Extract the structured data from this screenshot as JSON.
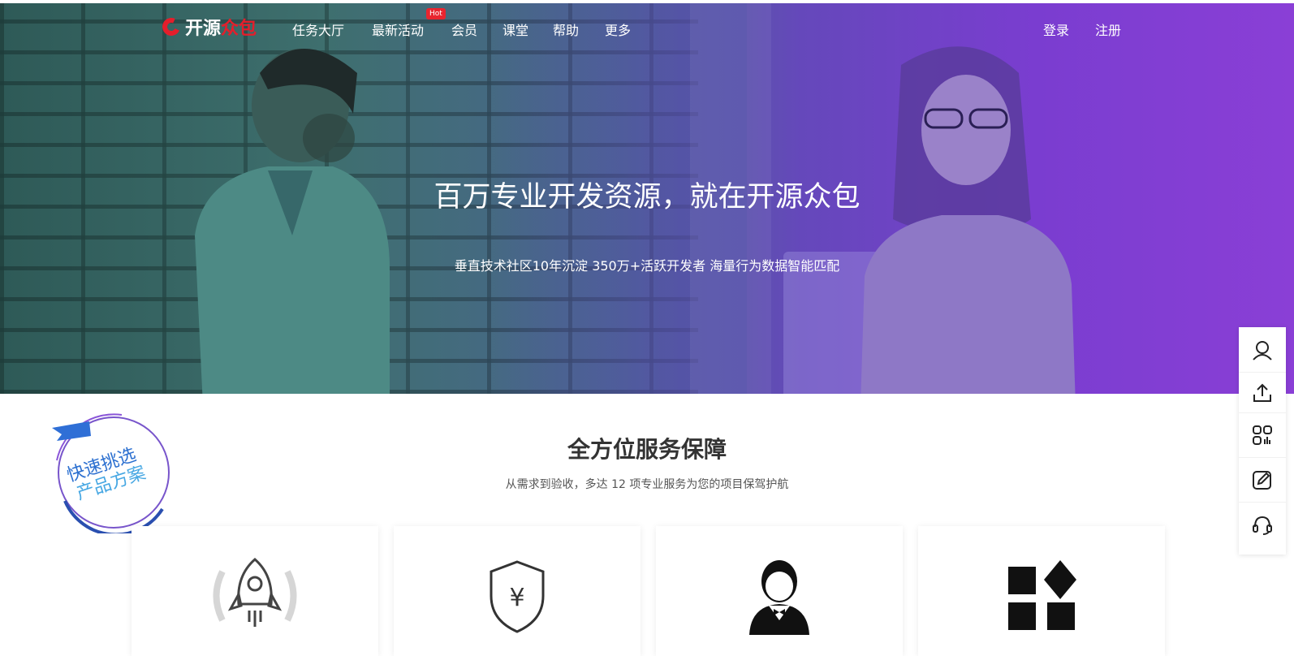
{
  "brand": {
    "name_part1": "开源",
    "name_part2": "众包"
  },
  "nav": {
    "items": [
      "任务大厅",
      "最新活动",
      "会员",
      "课堂",
      "帮助",
      "更多"
    ],
    "hot_badge": "Hot"
  },
  "auth": {
    "login": "登录",
    "register": "注册"
  },
  "hero": {
    "title": "百万专业开发资源，就在开源众包",
    "subtitle": "垂直技术社区10年沉淀   350万+活跃开发者   海量行为数据智能匹配"
  },
  "badge": {
    "line1": "快速挑选",
    "line2": "产品方案"
  },
  "section": {
    "title": "全方位服务保障",
    "subtitle": "从需求到验收，多达 12 项专业服务为您的项目保驾护航"
  },
  "cards": [
    {
      "icon": "rocket-icon"
    },
    {
      "icon": "shield-yen-icon"
    },
    {
      "icon": "butler-icon"
    },
    {
      "icon": "apps-grid-icon"
    }
  ],
  "sidebar": {
    "items": [
      "user-icon",
      "upload-icon",
      "qr-code-icon",
      "edit-icon",
      "headset-icon"
    ]
  },
  "colors": {
    "brand_red": "#e41e2b",
    "hero_left": "#2e5a57",
    "hero_right": "#8a3fd6"
  }
}
